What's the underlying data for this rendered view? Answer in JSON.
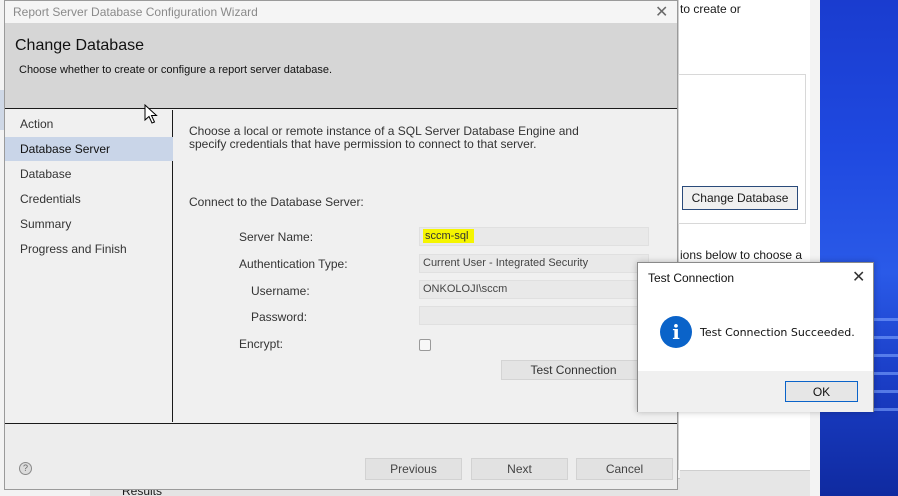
{
  "wizard": {
    "title": "Report Server Database Configuration Wizard",
    "header_title": "Change Database",
    "header_desc": "Choose whether to create or configure a report server database.",
    "nav": [
      {
        "label": "Action"
      },
      {
        "label": "Database Server"
      },
      {
        "label": "Database"
      },
      {
        "label": "Credentials"
      },
      {
        "label": "Summary"
      },
      {
        "label": "Progress and Finish"
      }
    ],
    "active_nav": "Database Server",
    "intro": "Choose a local or remote instance of a SQL Server Database Engine and specify credentials that have permission to connect to that server.",
    "section_label": "Connect to the Database Server:",
    "fields": {
      "server_name_label": "Server Name:",
      "server_name_value": "sccm-sql",
      "auth_label": "Authentication Type:",
      "auth_value": "Current User - Integrated Security",
      "username_label": "Username:",
      "username_value": "ONKOLOJI\\sccm",
      "password_label": "Password:",
      "password_value": "",
      "encrypt_label": "Encrypt:"
    },
    "test_connection_label": "Test Connection",
    "buttons": {
      "previous": "Previous",
      "next": "Next",
      "cancel": "Cancel"
    }
  },
  "background": {
    "top_text": "to create or",
    "change_database_button": "Change Database",
    "mid_text": "ions below to choose a",
    "results_label": "Results"
  },
  "dialog": {
    "title": "Test Connection",
    "message": "Test Connection Succeeded.",
    "ok": "OK"
  },
  "colors": {
    "highlight": "#f5f500",
    "info_blue": "#0a63c9",
    "active_nav": "#c9d5e8"
  }
}
